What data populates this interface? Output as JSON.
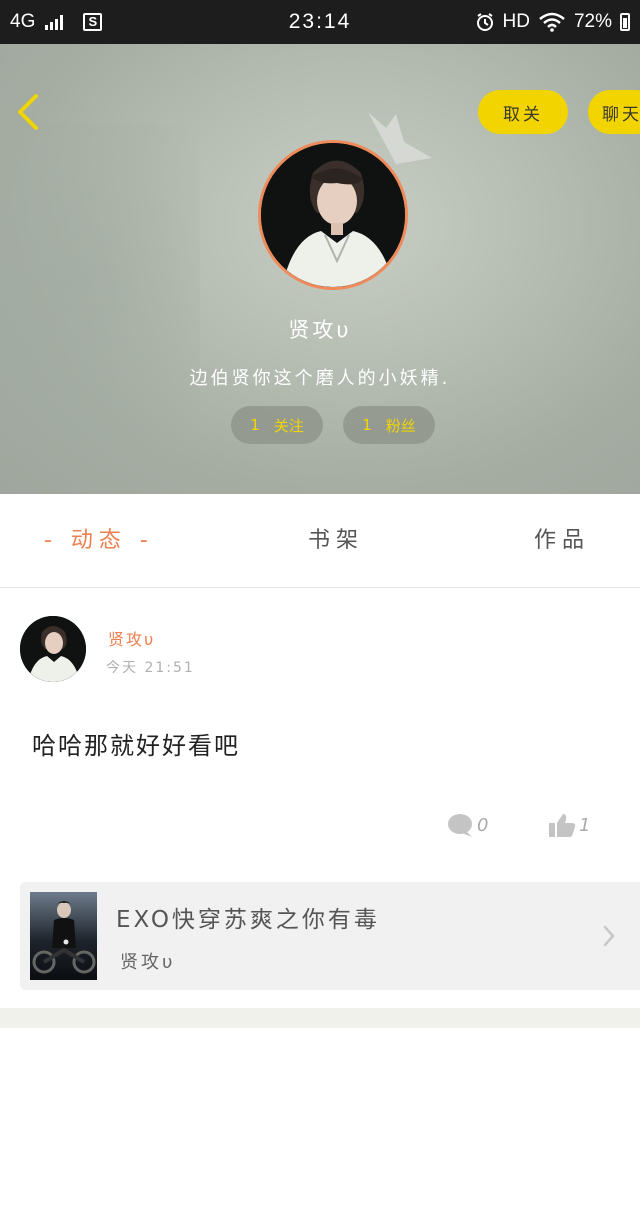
{
  "status_bar": {
    "network": "4G",
    "time": "23:14",
    "hd": "HD",
    "battery": "72%"
  },
  "header": {
    "unfollow_label": "取关",
    "chat_label": "聊天",
    "username": "贤攻υ",
    "bio": "边伯贤你这个磨人的小妖精.",
    "following_count": "1",
    "following_label": "关注",
    "fans_count": "1",
    "fans_label": "粉丝"
  },
  "tabs": {
    "active": "- 动态 -",
    "shelf": "书架",
    "works": "作品"
  },
  "post": {
    "author": "贤攻υ",
    "time": "今天 21:51",
    "text": "哈哈那就好好看吧",
    "comment_count": "0",
    "like_count": "1"
  },
  "book": {
    "title": "EXO快穿苏爽之你有毒",
    "author": "贤攻υ"
  },
  "colors": {
    "accent": "#ee7f4e",
    "yellow": "#f2d400"
  }
}
